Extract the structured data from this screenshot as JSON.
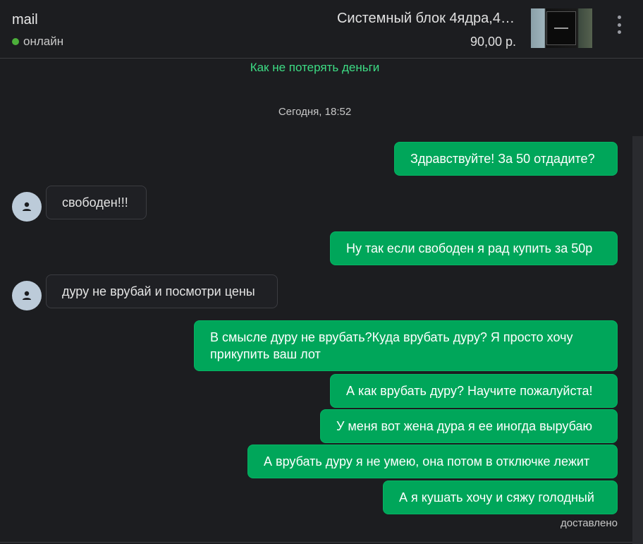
{
  "header": {
    "contact_name": "mail",
    "status": "онлайн",
    "item_title": "Системный блок 4ядра,4…",
    "item_price": "90,00 р.",
    "status_color": "#4caf3a"
  },
  "chat": {
    "warning_link": "Как не потерять деньги",
    "date_separator": "Сегодня, 18:52",
    "delivered_status": "доставлено",
    "messages": [
      {
        "direction": "out",
        "text": "Здравствуйте! За 50 отдадите?"
      },
      {
        "direction": "in",
        "text": "свободен!!!"
      },
      {
        "direction": "out",
        "text": "Ну так если свободен я рад купить за 50р"
      },
      {
        "direction": "in",
        "text": "дуру не врубай и посмотри цены"
      },
      {
        "direction": "out",
        "text": "В смысле дуру не врубать?Куда врубать дуру? Я просто хочу прикупить ваш лот"
      },
      {
        "direction": "out",
        "text": "А как врубать дуру? Научите пожалуйста!"
      },
      {
        "direction": "out",
        "text": "У меня вот жена дура я ее иногда вырубаю"
      },
      {
        "direction": "out",
        "text": "А врубать дуру я не умею, она потом в отключке лежит"
      },
      {
        "direction": "out",
        "text": "А я кушать хочу и сяжу голодный"
      }
    ]
  },
  "colors": {
    "outgoing_bubble": "#00a65a",
    "incoming_bubble": "#1f2024",
    "link": "#3ddc84",
    "background": "#1c1d20"
  },
  "icons": {
    "avatar": "user-icon",
    "menu": "more-vertical-icon"
  }
}
